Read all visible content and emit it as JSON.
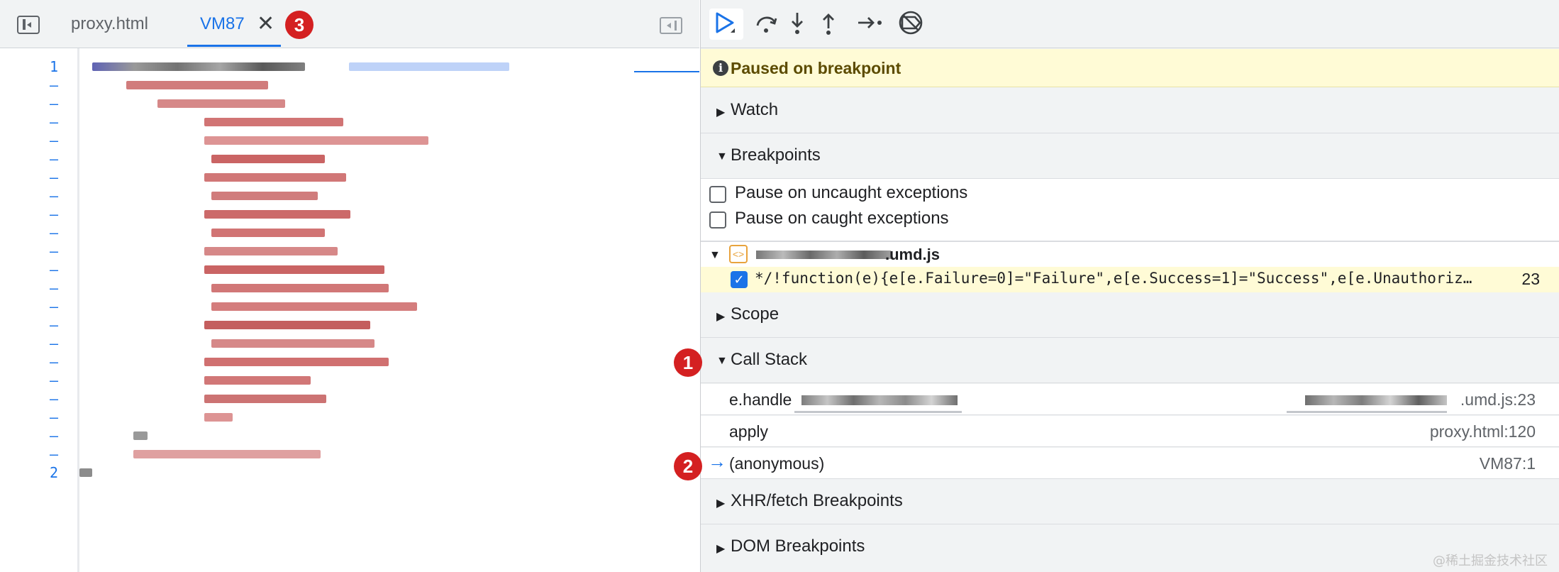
{
  "tabs": [
    {
      "label": "proxy.html"
    },
    {
      "label": "VM87",
      "active": true
    }
  ],
  "badges": {
    "one": "1",
    "two": "2",
    "three": "3"
  },
  "line_numbers": [
    "1",
    "–",
    "–",
    "–",
    "–",
    "–",
    "–",
    "–",
    "–",
    "–",
    "–",
    "–",
    "–",
    "–",
    "–",
    "–",
    "–",
    "–",
    "–",
    "–",
    "–",
    "–",
    "2"
  ],
  "debugger": {
    "paused_message": "Paused on breakpoint",
    "sections": {
      "watch": "Watch",
      "breakpoints": "Breakpoints",
      "scope": "Scope",
      "call_stack": "Call Stack",
      "xhr": "XHR/fetch Breakpoints",
      "dom": "DOM Breakpoints"
    },
    "pause_options": [
      {
        "label": "Pause on uncaught exceptions",
        "checked": false
      },
      {
        "label": "Pause on caught exceptions",
        "checked": false
      }
    ],
    "breakpoint_file": {
      "name_suffix": ".umd.js",
      "code": "*/!function(e){e[e.Failure=0]=\"Failure\",e[e.Success=1]=\"Success\",e[e.Unauthoriz…",
      "line": "23",
      "checked": true
    },
    "call_stack": [
      {
        "fn": "e.handle",
        "location": ".umd.js:23"
      },
      {
        "fn": "apply",
        "location": "proxy.html:120"
      },
      {
        "fn": "(anonymous)",
        "location": "VM87:1",
        "current": true
      }
    ]
  },
  "watermark": "@稀土掘金技术社区",
  "colors": {
    "accent": "#1a73e8",
    "badge": "#d42021",
    "paused_bg": "#fffbd6",
    "panel_bg": "#f1f3f4"
  },
  "icons": {
    "sidebar_toggle": "sidebar-toggle-icon",
    "close": "close-icon",
    "resume": "resume-icon",
    "step_over": "step-over-icon",
    "step_into": "step-into-icon",
    "step_out": "step-out-icon",
    "step": "step-icon",
    "deactivate": "deactivate-breakpoints-icon",
    "info": "info-icon"
  }
}
